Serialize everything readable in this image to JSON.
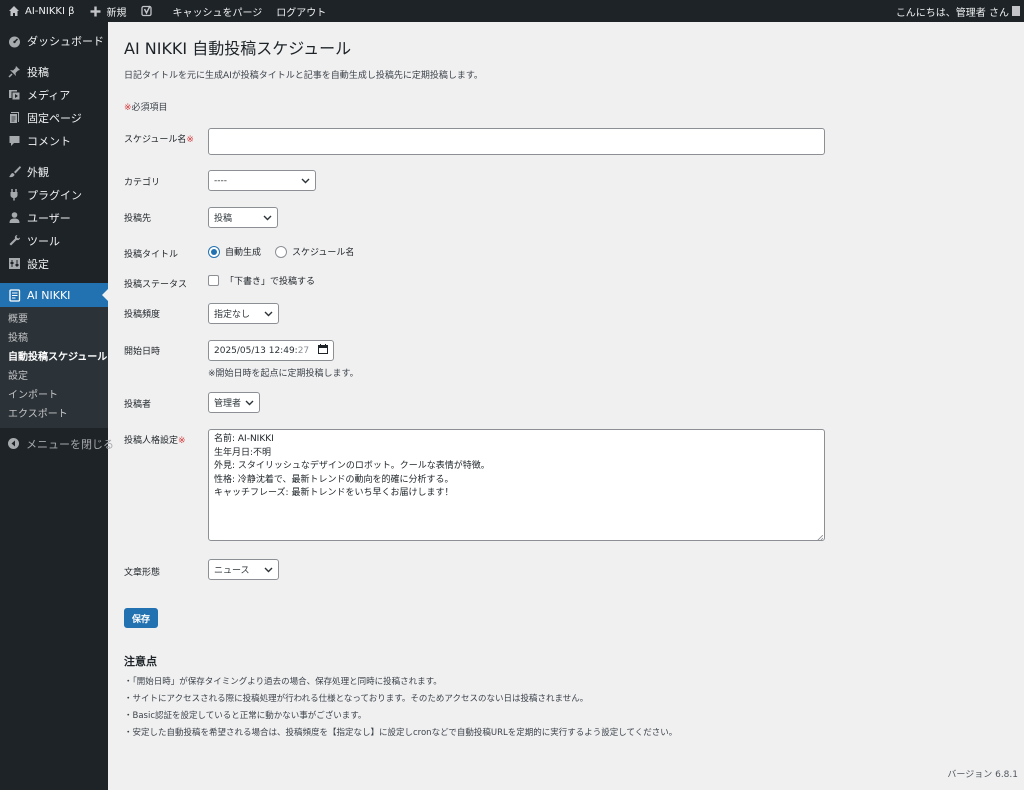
{
  "adminbar": {
    "site_name": "AI-NIKKI β",
    "new_label": "新規",
    "purge_label": "キャッシュをパージ",
    "logout_label": "ログアウト",
    "greeting": "こんにちは、管理者 さん"
  },
  "sidebar": {
    "items": [
      {
        "label": "ダッシュボード"
      },
      {
        "label": "投稿"
      },
      {
        "label": "メディア"
      },
      {
        "label": "固定ページ"
      },
      {
        "label": "コメント"
      },
      {
        "label": "外観"
      },
      {
        "label": "プラグイン"
      },
      {
        "label": "ユーザー"
      },
      {
        "label": "ツール"
      },
      {
        "label": "設定"
      },
      {
        "label": "AI NIKKI"
      }
    ],
    "submenu": [
      {
        "label": "概要"
      },
      {
        "label": "投稿"
      },
      {
        "label": "自動投稿スケジュール"
      },
      {
        "label": "設定"
      },
      {
        "label": "インポート"
      },
      {
        "label": "エクスポート"
      }
    ],
    "collapse_label": "メニューを閉じる"
  },
  "page": {
    "title": "AI NIKKI 自動投稿スケジュール",
    "description": "日記タイトルを元に生成AIが投稿タイトルと記事を自動生成し投稿先に定期投稿します。",
    "required_mark": "※",
    "required_note": "必須項目"
  },
  "form": {
    "schedule_name_label": "スケジュール名",
    "schedule_name_value": "",
    "category_label": "カテゴリ",
    "category_value": "----",
    "destination_label": "投稿先",
    "destination_value": "投稿",
    "title_label": "投稿タイトル",
    "title_option_auto": "自動生成",
    "title_option_schedule": "スケジュール名",
    "status_label": "投稿ステータス",
    "status_checkbox": "「下書き」で投稿する",
    "frequency_label": "投稿頻度",
    "frequency_value": "指定なし",
    "start_label": "開始日時",
    "start_value": "2025/05/13 12:49:",
    "start_seconds": "27",
    "start_hint": "※開始日時を起点に定期投稿します。",
    "author_label": "投稿者",
    "author_value": "管理者",
    "persona_label": "投稿人格設定",
    "persona_lines": [
      "名前: AI-NIKKI",
      "生年月日:不明",
      "外見: スタイリッシュなデザインのロボット。クールな表情が特徴。",
      "性格: 冷静沈着で、最新トレンドの動向を的確に分析する。",
      "キャッチフレーズ: 最新トレンドをいち早くお届けします！"
    ],
    "style_label": "文章形態",
    "style_value": "ニュース",
    "save_label": "保存"
  },
  "notes": {
    "title": "注意点",
    "items": [
      "・「開始日時」が保存タイミングより過去の場合、保存処理と同時に投稿されます。",
      "・サイトにアクセスされる際に投稿処理が行われる仕様となっております。そのためアクセスのない日は投稿されません。",
      "・Basic認証を設定していると正常に動かない事がございます。",
      "・安定した自動投稿を希望される場合は、投稿頻度を【指定なし】に設定しcronなどで自動投稿URLを定期的に実行するよう設定してください。"
    ]
  },
  "footer": {
    "version": "バージョン 6.8.1"
  },
  "colors": {
    "admin_bg": "#1d2327",
    "accent": "#2271b1",
    "required": "#d63638",
    "page_bg": "#f0f0f1"
  }
}
